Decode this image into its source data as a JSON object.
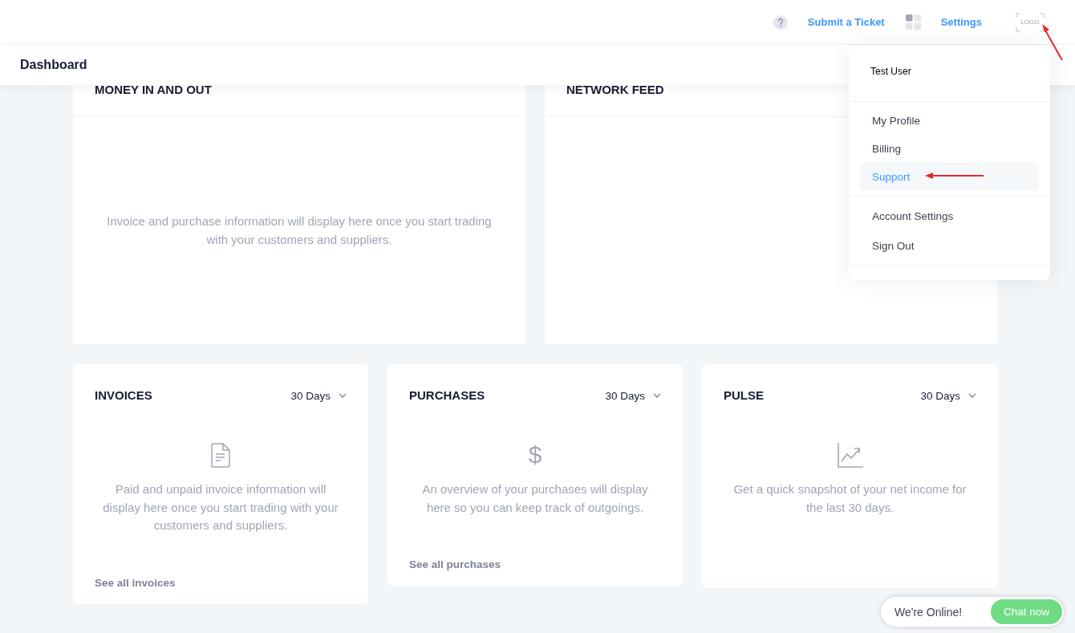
{
  "header": {
    "links": [
      {
        "label": "Submit a Ticket",
        "kind": "help"
      },
      {
        "label": "Settings",
        "kind": "apps"
      }
    ],
    "logo_text": "LOGO"
  },
  "page_title": "Dashboard",
  "top_cards": [
    {
      "title": "MONEY IN AND OUT",
      "message": "Invoice and purchase information will display here once you start trading with your customers and suppliers."
    },
    {
      "title": "NETWORK FEED"
    }
  ],
  "cards": [
    {
      "title": "INVOICES",
      "period": "30 Days",
      "kind": "document",
      "message": "Paid and unpaid invoice information will display here once you start trading with your customers and suppliers.",
      "link": "See all invoices"
    },
    {
      "title": "PURCHASES",
      "period": "30 Days",
      "kind": "symbol",
      "symbol": "$",
      "message": "An overview of your purchases will display here so you can keep track of outgoings.",
      "link": "See all purchases"
    },
    {
      "title": "PULSE",
      "period": "30 Days",
      "kind": "chart",
      "message": "Get a quick snapshot of your net income for the last 30 days."
    }
  ],
  "user_menu": {
    "user": "Test User",
    "groups": [
      {
        "items": [
          {
            "label": "My Profile",
            "selected": false
          },
          {
            "label": "Billing",
            "selected": false
          },
          {
            "label": "Support",
            "selected": true
          }
        ]
      },
      {
        "items": [
          {
            "label": "Account Settings",
            "selected": false
          },
          {
            "label": "Sign Out",
            "selected": false
          }
        ]
      }
    ]
  },
  "chat": {
    "status": "We're Online!",
    "button": "Chat now"
  }
}
